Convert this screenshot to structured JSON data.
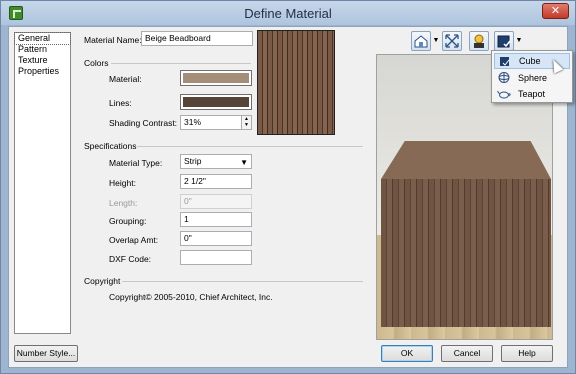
{
  "window": {
    "title": "Define Material",
    "close_label": "✕"
  },
  "nav": {
    "items": [
      "General",
      "Pattern",
      "Texture",
      "Properties"
    ]
  },
  "general": {
    "name_label": "Material Name:",
    "name_value": "Beige Beadboard",
    "colors_heading": "Colors",
    "material_label": "Material:",
    "material_color": "#a48e78",
    "lines_label": "Lines:",
    "lines_color": "#574438",
    "shading_label": "Shading Contrast:",
    "shading_value": "31%",
    "spec_heading": "Specifications",
    "material_type_label": "Material Type:",
    "material_type_value": "Strip",
    "height_label": "Height:",
    "height_value": "2 1/2\"",
    "length_label": "Length:",
    "length_value": "0\"",
    "grouping_label": "Grouping:",
    "grouping_value": "1",
    "overlap_label": "Overlap Amt:",
    "overlap_value": "0\"",
    "dxf_label": "DXF Code:",
    "dxf_value": "",
    "copyright_heading": "Copyright",
    "copyright_text": "Copyright© 2005-2010, Chief Architect, Inc."
  },
  "toolbar": {
    "icons": [
      "view-home-icon",
      "fit-view-icon",
      "lighting-icon",
      "shape-select-icon"
    ]
  },
  "shape_menu": {
    "items": [
      "Cube",
      "Sphere",
      "Teapot"
    ],
    "highlighted": "Cube"
  },
  "buttons": {
    "number_style": "Number Style...",
    "ok": "OK",
    "cancel": "Cancel",
    "help": "Help"
  }
}
